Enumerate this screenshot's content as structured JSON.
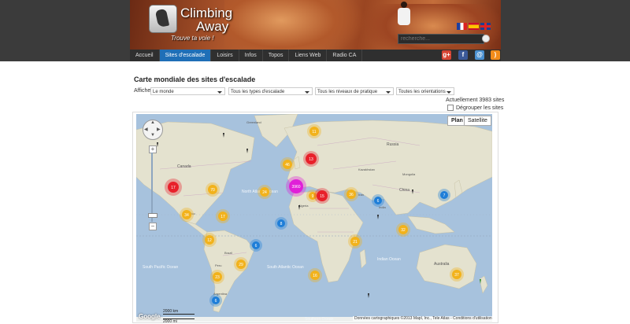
{
  "header": {
    "logo_line1": "Climbing",
    "logo_line2": "Away",
    "tagline": "Trouve ta voie !",
    "search_placeholder": "recherche..."
  },
  "nav": {
    "items": [
      "Accueil",
      "Sites d'escalade",
      "Loisirs",
      "Infos",
      "Topos",
      "Liens Web",
      "Radio CA"
    ],
    "active_index": 1
  },
  "social_icons": [
    "google-plus-icon",
    "facebook-icon",
    "email-icon",
    "rss-icon"
  ],
  "page": {
    "title": "Carte mondiale des sites d'escalade"
  },
  "filters": {
    "label": "Afficher",
    "selects": [
      {
        "value": "Le monde"
      },
      {
        "value": "Tous les types d'escalade"
      },
      {
        "value": "Tous les niveaux de pratique"
      },
      {
        "value": "Toutes les orientations"
      }
    ]
  },
  "sites_count": "Actuellement 3983 sites",
  "ungroup_label": "Dégrouper les sites",
  "map": {
    "type_buttons": [
      "Plan",
      "Satellite"
    ],
    "active_type": "Plan",
    "google_label": "Google",
    "scale": [
      "2000 km",
      "2000 mi"
    ],
    "attribution": "Données cartographiques ©2013 Mapl, Inc., Tele Atlas - Conditions d'utilisation",
    "ocean_labels": [
      "North Atlantic Ocean",
      "South Pacific Ocean",
      "South Atlantic Ocean",
      "Indian Ocean",
      "Southern Ocean"
    ],
    "place_labels": [
      "Greenland",
      "Canada",
      "Russia",
      "Kazakhstan",
      "China",
      "Brazil",
      "Australia",
      "Algeria",
      "Mongolia",
      "Argentina",
      "India",
      "Iran",
      "Mexico",
      "Peru"
    ],
    "clusters": [
      {
        "label": "11",
        "color": "#f2b21b"
      },
      {
        "label": "13",
        "color": "#e8202a"
      },
      {
        "label": "46",
        "color": "#f2b21b"
      },
      {
        "label": "17",
        "color": "#e8202a"
      },
      {
        "label": "9",
        "color": "#f2b21b"
      },
      {
        "label": "70",
        "color": "#f2b21b"
      },
      {
        "label": "24",
        "color": "#f2b21b"
      },
      {
        "label": "3960",
        "color": "#e020d8"
      },
      {
        "label": "15",
        "color": "#e8202a"
      },
      {
        "label": "36",
        "color": "#f2b21b"
      },
      {
        "label": "6",
        "color": "#1e7ed8"
      },
      {
        "label": "7",
        "color": "#1e7ed8"
      },
      {
        "label": "34",
        "color": "#f2b21b"
      },
      {
        "label": "17",
        "color": "#f2b21b"
      },
      {
        "label": "8",
        "color": "#1e7ed8"
      },
      {
        "label": "21",
        "color": "#f2b21b"
      },
      {
        "label": "32",
        "color": "#f2b21b"
      },
      {
        "label": "12",
        "color": "#f2b21b"
      },
      {
        "label": "6",
        "color": "#1e7ed8"
      },
      {
        "label": "29",
        "color": "#f2b21b"
      },
      {
        "label": "23",
        "color": "#f2b21b"
      },
      {
        "label": "16",
        "color": "#f2b21b"
      },
      {
        "label": "37",
        "color": "#f2b21b"
      },
      {
        "label": "6",
        "color": "#1e7ed8"
      }
    ]
  }
}
